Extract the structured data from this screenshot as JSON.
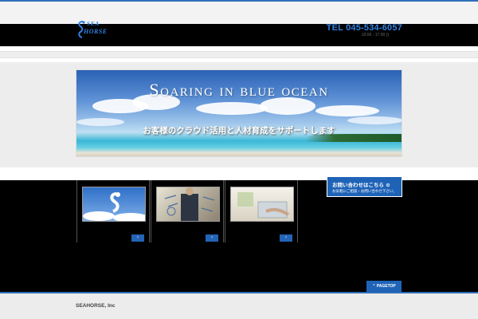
{
  "brand": {
    "logo_top": "SEA",
    "logo_bottom": "HORSE"
  },
  "header": {
    "tel": "TEL 045-534-6057",
    "hours": "10:00 - 17:00 ()"
  },
  "hero": {
    "title": "Soaring in blue ocean",
    "subtitle": "お客様のクラウド活用と人材育成をサポートします"
  },
  "cards": [
    {
      "button": "›"
    },
    {
      "button": "›"
    },
    {
      "button": "›"
    }
  ],
  "contact": {
    "label": "お問い合わせはこちら ⊙",
    "sub": "お気軽にご相談・お問い合わせ下さい。"
  },
  "pagetop": {
    "label": "⌃ PAGETOP"
  },
  "footer": {
    "company": "SEAHORSE, Inc"
  },
  "colors": {
    "accent": "#1f63b7",
    "header_bg": "#000000"
  }
}
